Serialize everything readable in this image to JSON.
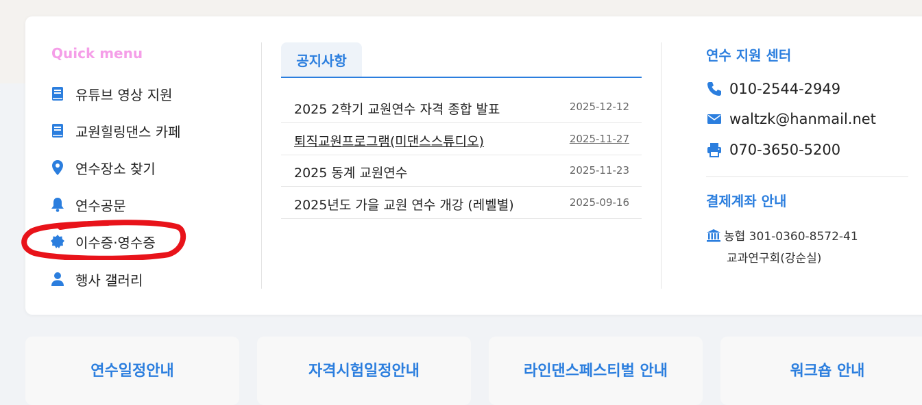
{
  "quick_menu": {
    "title": "Quick menu",
    "items": [
      {
        "label": "유튜브 영상 지원",
        "icon": "book-icon"
      },
      {
        "label": "교원힐링댄스 카페",
        "icon": "book-icon"
      },
      {
        "label": "연수장소 찾기",
        "icon": "map-pin-icon"
      },
      {
        "label": "연수공문",
        "icon": "bell-icon"
      },
      {
        "label": "이수증·영수증",
        "icon": "badge-certificate-icon"
      },
      {
        "label": "행사 갤러리",
        "icon": "user-icon"
      }
    ]
  },
  "notice": {
    "tab_label": "공지사항",
    "rows": [
      {
        "title": "2025 2학기 교원연수 자격 종합 발표",
        "date": "2025-12-12"
      },
      {
        "title": "퇴직교원프로그램(미댄스스튜디오)",
        "date": "2025-11-27"
      },
      {
        "title": "2025 동계 교원연수",
        "date": "2025-11-23"
      },
      {
        "title": "2025년도 가을 교원 연수 개강 (레벨별)",
        "date": "2025-09-16"
      }
    ]
  },
  "support": {
    "heading": "연수 지원 센터",
    "phone": "010-2544-2949",
    "email": "waltzk@hanmail.net",
    "fax": "070-3650-5200",
    "payment_heading": "결제계좌 안내",
    "bank": "농협 301-0360-8572-41",
    "holder": "교과연구회(강순실)"
  },
  "bottom_cards": [
    {
      "label": "연수일정안내"
    },
    {
      "label": "자격시험일정안내"
    },
    {
      "label": "라인댄스페스티벌 안내"
    },
    {
      "label": "워크숍 안내"
    }
  ],
  "colors": {
    "accent": "#2b7ede",
    "quick_menu_title": "#f59ee8",
    "annotation": "#e8131a"
  }
}
